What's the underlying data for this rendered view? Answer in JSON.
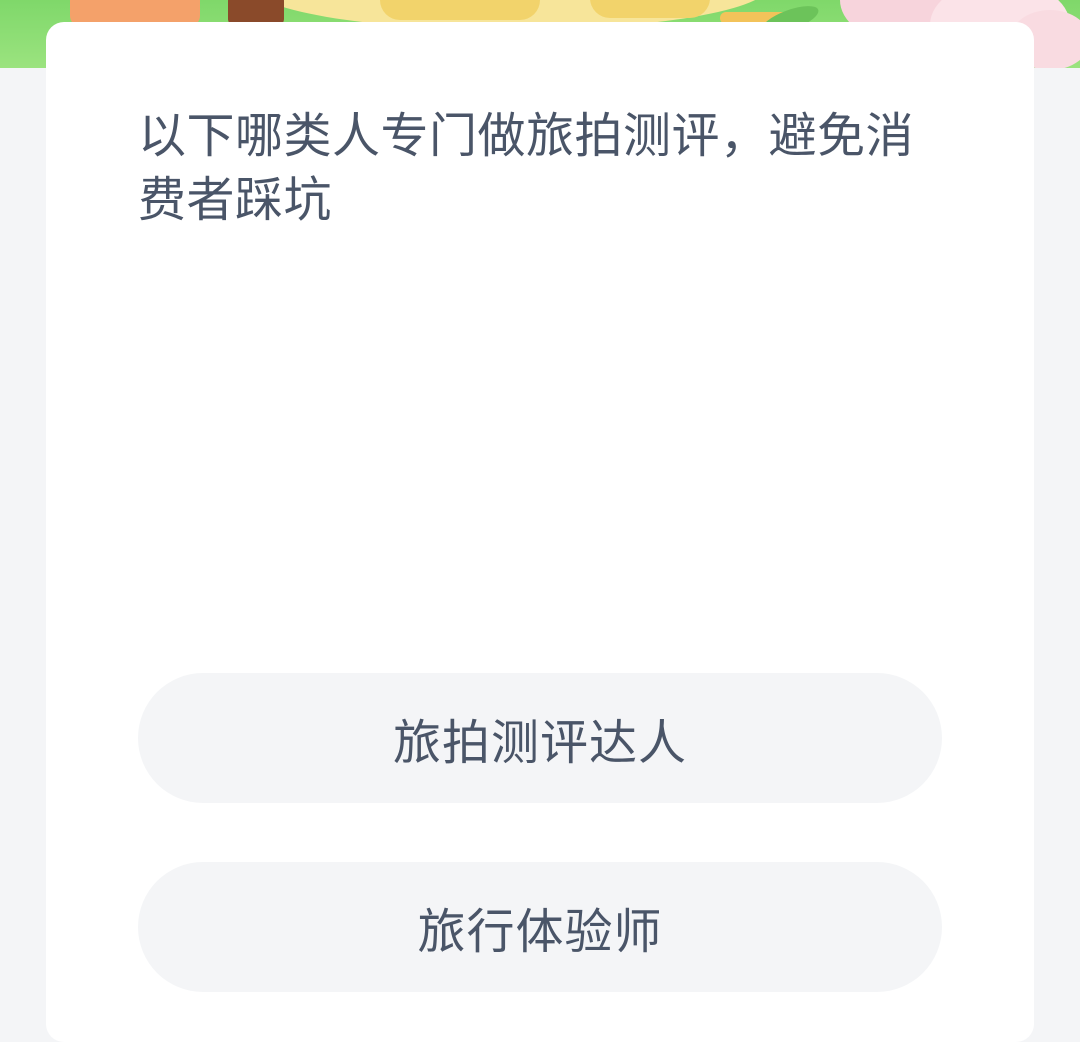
{
  "question": {
    "text": "以下哪类人专门做旅拍测评，避免消费者踩坑"
  },
  "options": [
    {
      "label": "旅拍测评达人"
    },
    {
      "label": "旅行体验师"
    }
  ],
  "colors": {
    "banner_green": "#7fd86a",
    "card_bg": "#ffffff",
    "page_bg": "#f4f5f7",
    "option_bg": "#f4f5f7",
    "text": "#4a5568"
  }
}
